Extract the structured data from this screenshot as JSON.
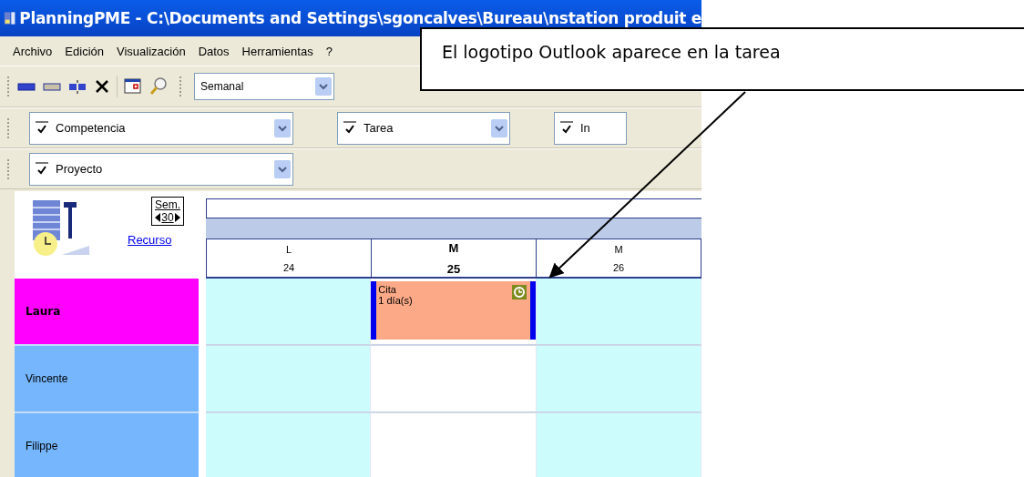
{
  "window": {
    "title": "PlanningPME - C:\\Documents and Settings\\sgoncalves\\Bureau\\nstation produit e"
  },
  "menu": [
    "Archivo",
    "Edición",
    "Visualización",
    "Datos",
    "Herramientas",
    "?"
  ],
  "toolbar": {
    "view": "Semanal"
  },
  "filters": [
    {
      "label": "Competencia",
      "checked": true
    },
    {
      "label": "Tarea",
      "checked": true
    },
    {
      "label": "In",
      "checked": true
    }
  ],
  "filters_row2": [
    {
      "label": "Proyecto",
      "checked": true
    }
  ],
  "planner": {
    "week_label": "Sem.",
    "week": "30",
    "resource_link": "Recurso",
    "days": [
      {
        "letter": "L",
        "date": "24",
        "today": false,
        "shaded": true
      },
      {
        "letter": "M",
        "date": "25",
        "today": true,
        "shaded": false
      },
      {
        "letter": "M",
        "date": "26",
        "today": false,
        "shaded": true
      }
    ],
    "resources": [
      {
        "name": "Laura",
        "selected": true,
        "slots": [
          {
            "kind": "empty"
          },
          {
            "kind": "task",
            "title": "Cita",
            "duration": "1 día(s)",
            "outlook": true
          },
          {
            "kind": "empty"
          }
        ]
      },
      {
        "name": "Vincente",
        "selected": false,
        "slots": [
          {
            "kind": "empty"
          },
          {
            "kind": "empty"
          },
          {
            "kind": "empty"
          }
        ]
      },
      {
        "name": "Filippe",
        "selected": false,
        "slots": [
          {
            "kind": "empty"
          },
          {
            "kind": "empty"
          },
          {
            "kind": "empty"
          }
        ]
      }
    ]
  },
  "callout": {
    "text": "El logotipo Outlook aparece en la tarea"
  }
}
